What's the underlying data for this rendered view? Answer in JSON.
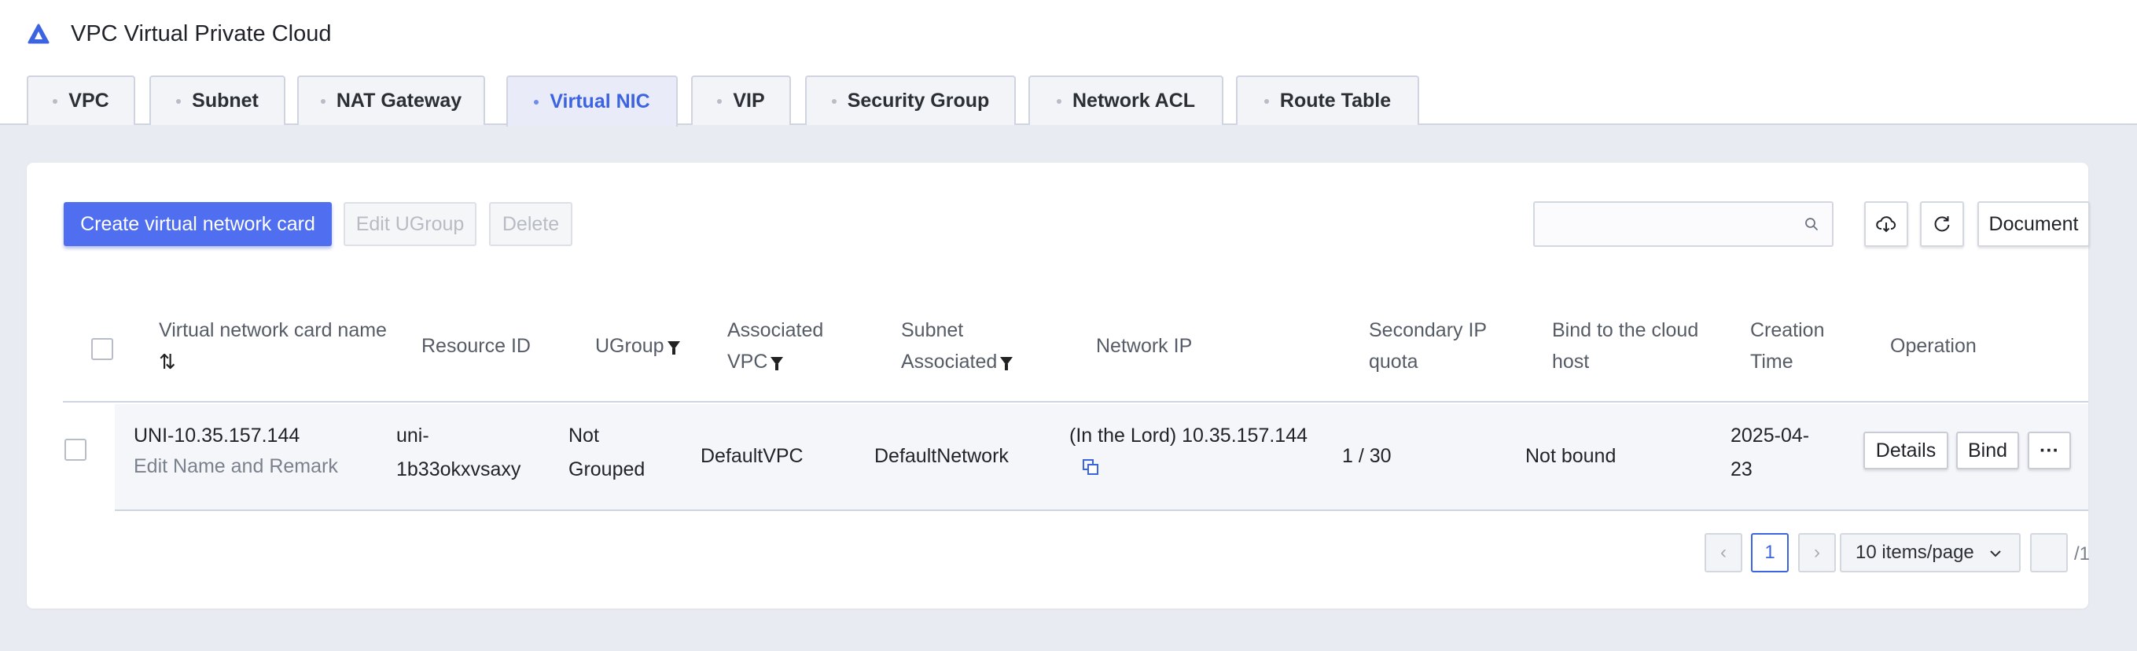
{
  "app": {
    "title": "VPC Virtual Private Cloud",
    "logo_icon": "triangle-logo-icon"
  },
  "tabs": [
    {
      "label": "VPC",
      "active": false
    },
    {
      "label": "Subnet",
      "active": false
    },
    {
      "label": "NAT Gateway",
      "active": false
    },
    {
      "label": "Virtual NIC",
      "active": true
    },
    {
      "label": "VIP",
      "active": false
    },
    {
      "label": "Security Group",
      "active": false
    },
    {
      "label": "Network ACL",
      "active": false
    },
    {
      "label": "Route Table",
      "active": false
    }
  ],
  "toolbar": {
    "create_label": "Create virtual network card",
    "edit_ugroup_label": "Edit UGroup",
    "delete_label": "Delete",
    "search_placeholder": "",
    "document_label": "Document"
  },
  "table": {
    "headers": {
      "name_line1": "Virtual network card name",
      "resource_id": "Resource ID",
      "ugroup": "UGroup",
      "assoc_vpc_line1": "Associated",
      "assoc_vpc_line2": "VPC",
      "subnet_line1": "Subnet",
      "subnet_line2": "Associated",
      "network_ip": "Network IP",
      "secondary_line1": "Secondary IP",
      "secondary_line2": "quota",
      "bind_line1": "Bind to the cloud",
      "bind_line2": "host",
      "creation_line1": "Creation",
      "creation_line2": "Time",
      "operation": "Operation"
    },
    "rows": [
      {
        "name": "UNI-10.35.157.144",
        "edit_link": "Edit Name and Remark",
        "resource_id_line1": "uni-",
        "resource_id_line2": "1b33okxvsaxy",
        "ugroup_line1": "Not",
        "ugroup_line2": "Grouped",
        "vpc": "DefaultVPC",
        "subnet": "DefaultNetwork",
        "network_ip": "(In the Lord) 10.35.157.144",
        "secondary_quota": "1 / 30",
        "bind_status": "Not bound",
        "creation_line1": "2025-04-",
        "creation_line2": "23",
        "details_label": "Details",
        "bind_label": "Bind",
        "more_label": "···"
      }
    ]
  },
  "pagination": {
    "current_page": "1",
    "page_size_label": "10 items/page",
    "page_jump_value": "",
    "total_pages": "/1"
  },
  "colors": {
    "primary": "#4f6ef0",
    "active_tab_text": "#3d64e0",
    "background": "#e9ebf2"
  }
}
